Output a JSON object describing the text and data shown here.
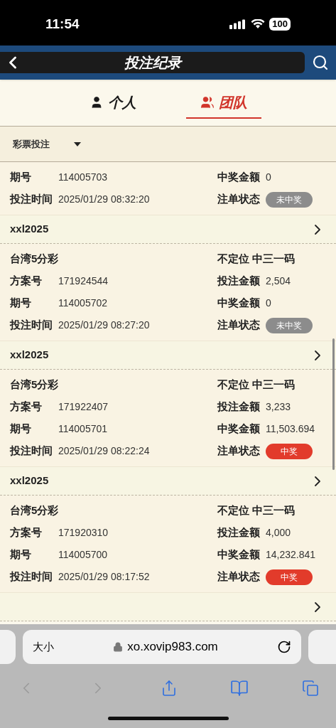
{
  "status_bar": {
    "time": "11:54",
    "battery": "100"
  },
  "nav": {
    "title": "投注纪录"
  },
  "tabs": [
    {
      "label": "个人",
      "kind": "person",
      "selected": false
    },
    {
      "label": "团队",
      "kind": "group",
      "selected": true
    }
  ],
  "filter": {
    "label": "彩票投注"
  },
  "items": [
    {
      "kind": "record",
      "rows": [
        {
          "kind": "field",
          "label": "期号",
          "value": "114005703",
          "right_label": "中奖金额",
          "right_value": "0"
        },
        {
          "kind": "status",
          "label": "投注时间",
          "value": "2025/01/29 08:32:20",
          "right_label": "注单状态",
          "badge": "未中奖",
          "won": false
        }
      ]
    },
    {
      "kind": "header",
      "user": "xxl2025"
    },
    {
      "kind": "record",
      "rows": [
        {
          "kind": "title",
          "game": "台湾5分彩",
          "play": "不定位 中三一码"
        },
        {
          "kind": "field",
          "label": "方案号",
          "value": "171924544",
          "right_label": "投注金额",
          "right_value": "2,504"
        },
        {
          "kind": "field",
          "label": "期号",
          "value": "114005702",
          "right_label": "中奖金额",
          "right_value": "0"
        },
        {
          "kind": "status",
          "label": "投注时间",
          "value": "2025/01/29 08:27:20",
          "right_label": "注单状态",
          "badge": "未中奖",
          "won": false
        }
      ]
    },
    {
      "kind": "header",
      "user": "xxl2025"
    },
    {
      "kind": "record",
      "rows": [
        {
          "kind": "title",
          "game": "台湾5分彩",
          "play": "不定位 中三一码"
        },
        {
          "kind": "field",
          "label": "方案号",
          "value": "171922407",
          "right_label": "投注金额",
          "right_value": "3,233"
        },
        {
          "kind": "field",
          "label": "期号",
          "value": "114005701",
          "right_label": "中奖金额",
          "right_value": "11,503.694"
        },
        {
          "kind": "status",
          "label": "投注时间",
          "value": "2025/01/29 08:22:24",
          "right_label": "注单状态",
          "badge": "中奖",
          "won": true
        }
      ]
    },
    {
      "kind": "header",
      "user": "xxl2025"
    },
    {
      "kind": "record",
      "rows": [
        {
          "kind": "title",
          "game": "台湾5分彩",
          "play": "不定位 中三一码"
        },
        {
          "kind": "field",
          "label": "方案号",
          "value": "171920310",
          "right_label": "投注金额",
          "right_value": "4,000"
        },
        {
          "kind": "field",
          "label": "期号",
          "value": "114005700",
          "right_label": "中奖金额",
          "right_value": "14,232.841"
        },
        {
          "kind": "status",
          "label": "投注时间",
          "value": "2025/01/29 08:17:52",
          "right_label": "注单状态",
          "badge": "中奖",
          "won": true
        }
      ]
    },
    {
      "kind": "header"
    }
  ],
  "browser": {
    "text_size": "大小",
    "url": "xo.xovip983.com"
  }
}
